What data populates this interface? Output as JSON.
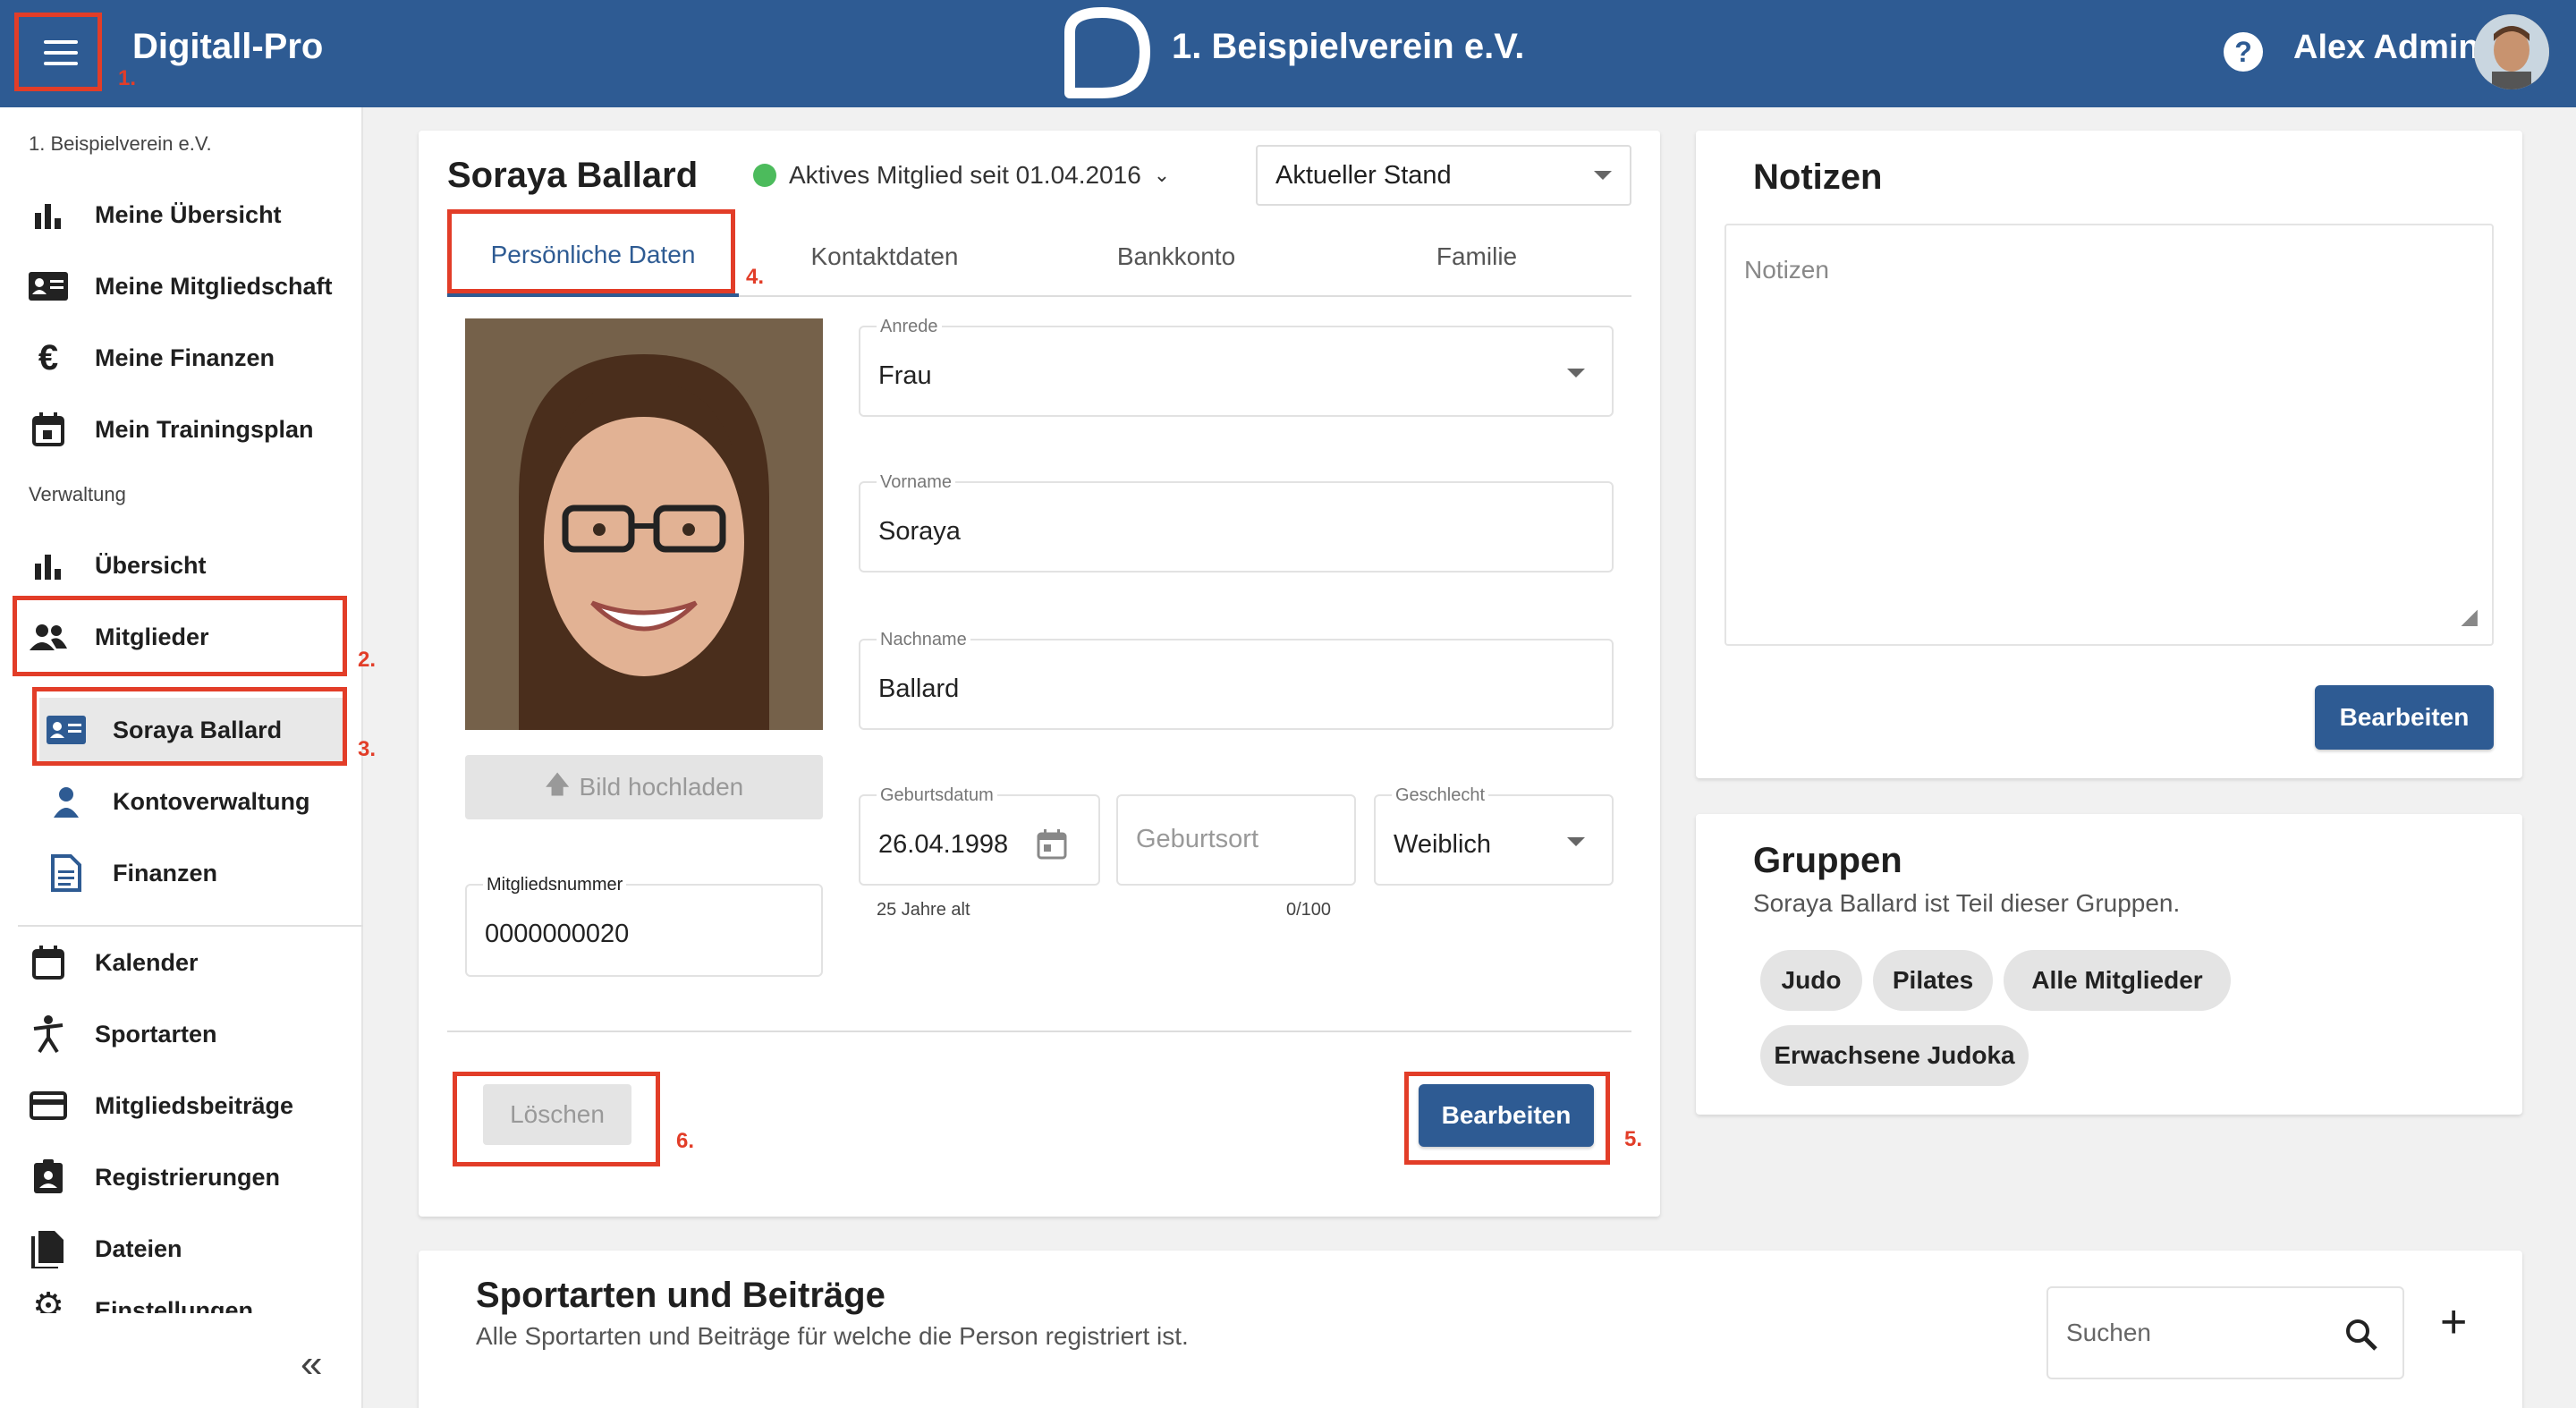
{
  "header": {
    "app_title": "Digitall-Pro",
    "club_name": "1. Beispielverein e.V.",
    "help_glyph": "?",
    "user_name": "Alex Admin",
    "brand_color": "#2e5b93"
  },
  "sidebar": {
    "club_label": "1. Beispielverein e.V.",
    "personal_items": [
      {
        "label": "Meine Übersicht",
        "icon": "bar-chart-icon"
      },
      {
        "label": "Meine Mitgliedschaft",
        "icon": "id-card-icon"
      },
      {
        "label": "Meine Finanzen",
        "icon": "euro-icon"
      },
      {
        "label": "Mein Trainingsplan",
        "icon": "calendar-icon"
      }
    ],
    "admin_label": "Verwaltung",
    "admin_items": [
      {
        "label": "Übersicht",
        "icon": "bar-chart-icon"
      },
      {
        "label": "Mitglieder",
        "icon": "people-icon"
      },
      {
        "label": "Soraya Ballard",
        "icon": "id-card-icon"
      },
      {
        "label": "Kontoverwaltung",
        "icon": "person-icon"
      },
      {
        "label": "Finanzen",
        "icon": "document-icon"
      }
    ],
    "general_items": [
      {
        "label": "Kalender",
        "icon": "calendar-icon"
      },
      {
        "label": "Sportarten",
        "icon": "sport-icon"
      },
      {
        "label": "Mitgliedsbeiträge",
        "icon": "credit-card-icon"
      },
      {
        "label": "Registrierungen",
        "icon": "badge-icon"
      },
      {
        "label": "Dateien",
        "icon": "files-icon"
      },
      {
        "label": "Einstellungen",
        "icon": "gear-icon"
      }
    ],
    "collapse_glyph": "«"
  },
  "member": {
    "name": "Soraya Ballard",
    "status": "Aktives Mitglied seit 01.04.2016",
    "status_color": "#4cbb5c",
    "version_select": "Aktueller Stand",
    "tabs": [
      "Persönliche Daten",
      "Kontaktdaten",
      "Bankkonto",
      "Familie"
    ],
    "upload_label": "Bild hochladen",
    "member_number_label": "Mitgliedsnummer",
    "member_number": "0000000020",
    "fields": {
      "salutation_label": "Anrede",
      "salutation": "Frau",
      "firstname_label": "Vorname",
      "firstname": "Soraya",
      "lastname_label": "Nachname",
      "lastname": "Ballard",
      "birthdate_label": "Geburtsdatum",
      "birthdate": "26.04.1998",
      "birthplace_placeholder": "Geburtsort",
      "gender_label": "Geschlecht",
      "gender": "Weiblich",
      "age_hint": "25 Jahre alt",
      "char_counter": "0/100"
    },
    "delete_label": "Löschen",
    "edit_label": "Bearbeiten"
  },
  "notes": {
    "title": "Notizen",
    "placeholder": "Notizen",
    "edit_label": "Bearbeiten"
  },
  "groups": {
    "title": "Gruppen",
    "subtitle": "Soraya Ballard ist Teil dieser Gruppen.",
    "chips": [
      "Judo",
      "Pilates",
      "Alle Mitglieder",
      "Erwachsene Judoka"
    ]
  },
  "sports": {
    "title": "Sportarten und Beiträge",
    "subtitle": "Alle Sportarten und Beiträge für welche die Person registriert ist.",
    "search_placeholder": "Suchen",
    "add_glyph": "+"
  },
  "annotations": [
    "1.",
    "2.",
    "3.",
    "4.",
    "5.",
    "6."
  ]
}
